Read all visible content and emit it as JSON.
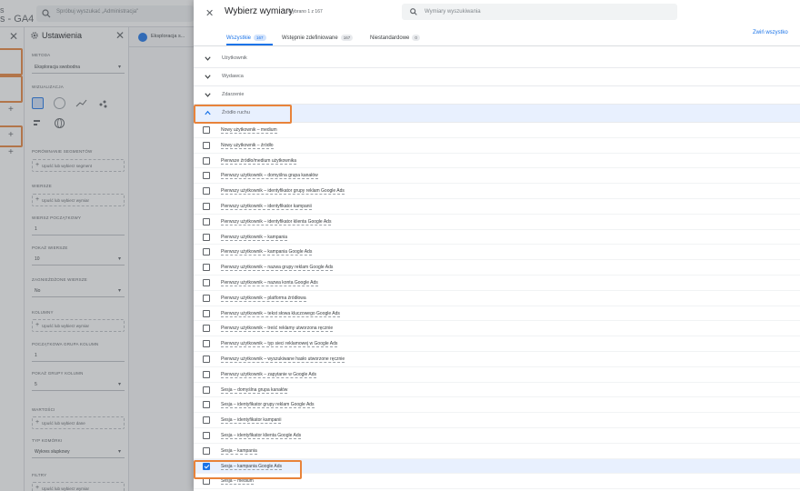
{
  "background_app": {
    "title_line1": "s",
    "title_line2": "s - GA4",
    "search_placeholder": "Spróbuj wyszukać „Administracja\"",
    "settings": {
      "title": "Ustawienia",
      "technique_label": "METODA",
      "technique_value": "Eksploracja swobodna",
      "visualization_label": "WIZUALIZACJA",
      "segment_compare_label": "PORÓWNANIE SEGMENTÓW",
      "segment_drop": "Upuść lub wybierz segment",
      "rows_label": "WIERSZE",
      "rows_drop": "Upuść lub wybierz wymiar",
      "start_row_label": "WIERSZ POCZĄTKOWY",
      "start_row_value": "1",
      "show_rows_label": "POKAŻ WIERSZE",
      "show_rows_value": "10",
      "nested_rows_label": "ZAGNIEŻDŻONE WIERSZE",
      "nested_rows_value": "No",
      "columns_label": "KOLUMNY",
      "columns_drop": "Upuść lub wybierz wymiar",
      "start_col_group_label": "POCZĄTKOWA GRUPA KOLUMN",
      "start_col_group_value": "1",
      "show_col_groups_label": "POKAŻ GRUPY KOLUMN",
      "show_col_groups_value": "5",
      "values_label": "WARTOŚCI",
      "values_drop": "Upuść lub wybierz dane",
      "cell_type_label": "TYP KOMÓRKI",
      "cell_type_value": "Wykres słupkowy",
      "filters_label": "FILTRY",
      "filters_drop": "Upuść lub wybierz wymiar"
    },
    "tab": {
      "label": "Eksploracja s..."
    }
  },
  "panel": {
    "title": "Wybierz wymiary",
    "subtitle": "Wybrano 1 z 167",
    "search_placeholder": "Wymiary wyszukiwania",
    "tabs": [
      {
        "label": "Wszystkie",
        "count": "167"
      },
      {
        "label": "Wstępnie zdefiniowane",
        "count": "167"
      },
      {
        "label": "Niestandardowe",
        "count": "0"
      }
    ],
    "collapse_all": "Zwiń wszystko",
    "groups": [
      {
        "label": "Użytkownik"
      },
      {
        "label": "Wydawca"
      },
      {
        "label": "Zdarzenie"
      },
      {
        "label": "Źródło ruchu"
      }
    ],
    "items": [
      {
        "label": "Nowy użytkownik – medium",
        "checked": false
      },
      {
        "label": "Nowy użytkownik – źródło",
        "checked": false
      },
      {
        "label": "Pierwsze źródło/medium użytkownika",
        "checked": false
      },
      {
        "label": "Pierwszy użytkownik – domyślna grupa kanałów",
        "checked": false
      },
      {
        "label": "Pierwszy użytkownik – identyfikator grupy reklam Google Ads",
        "checked": false
      },
      {
        "label": "Pierwszy użytkownik – identyfikator kampanii",
        "checked": false
      },
      {
        "label": "Pierwszy użytkownik – identyfikator klienta Google Ads",
        "checked": false
      },
      {
        "label": "Pierwszy użytkownik – kampania",
        "checked": false
      },
      {
        "label": "Pierwszy użytkownik – kampania Google Ads",
        "checked": false
      },
      {
        "label": "Pierwszy użytkownik – nazwa grupy reklam Google Ads",
        "checked": false
      },
      {
        "label": "Pierwszy użytkownik – nazwa konta Google Ads",
        "checked": false
      },
      {
        "label": "Pierwszy użytkownik – platforma źródłowa",
        "checked": false
      },
      {
        "label": "Pierwszy użytkownik – tekst słowa kluczowego Google Ads",
        "checked": false
      },
      {
        "label": "Pierwszy użytkownik – treść reklamy utworzona ręcznie",
        "checked": false
      },
      {
        "label": "Pierwszy użytkownik – typ sieci reklamowej w Google Ads",
        "checked": false
      },
      {
        "label": "Pierwszy użytkownik – wyszukiwane hasło utworzone ręcznie",
        "checked": false
      },
      {
        "label": "Pierwszy użytkownik – zapytanie w Google Ads",
        "checked": false
      },
      {
        "label": "Sesja – domyślna grupa kanałów",
        "checked": false
      },
      {
        "label": "Sesja – identyfikator grupy reklam Google Ads",
        "checked": false
      },
      {
        "label": "Sesja – identyfikator kampanii",
        "checked": false
      },
      {
        "label": "Sesja – identyfikator klienta Google Ads",
        "checked": false
      },
      {
        "label": "Sesja – kampania",
        "checked": false
      },
      {
        "label": "Sesja – kampania Google Ads",
        "checked": true
      },
      {
        "label": "Sesja – medium",
        "checked": false
      }
    ]
  }
}
